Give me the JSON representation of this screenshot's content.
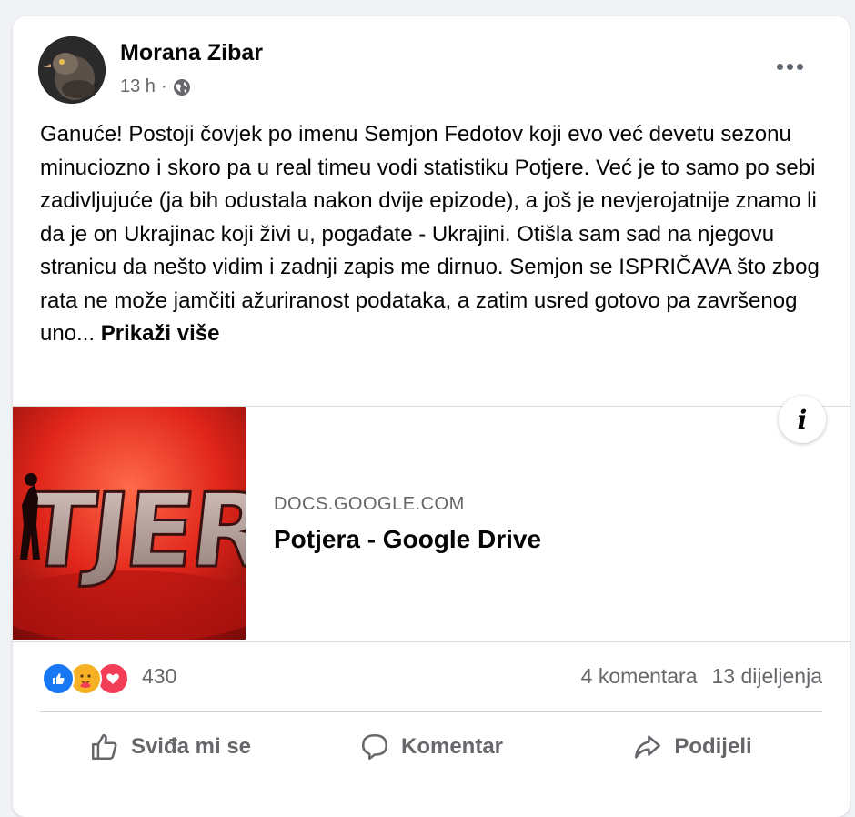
{
  "post": {
    "author": "Morana Zibar",
    "time": "13 h",
    "separator": "·",
    "visibility_icon": "globe-icon",
    "more_icon": "more-options-icon",
    "text": "Ganuće! Postoji čovjek po imenu Semjon Fedotov koji evo već devetu sezonu minuciozno i skoro pa u real timeu vodi statistiku Potjere. Već je to samo po sebi zadivljujuće (ja bih odustala nakon dvije epizode), a još je nevjerojatnije znamo li da je on Ukrajinac koji živi u, pogađate - Ukrajini. Otišla sam sad na njegovu stranicu da nešto vidim i zadnji zapis me dirnuo. Semjon se ISPRIČAVA što zbog rata ne može jamčiti ažuriranost podataka, a zatim usred gotovo pa završenog uno...",
    "see_more": "Prikaži više"
  },
  "link_preview": {
    "domain": "DOCS.GOOGLE.COM",
    "title": "Potjera - Google Drive",
    "thumb_text": "TJER",
    "info_label": "i"
  },
  "stats": {
    "reactions": [
      "like-icon",
      "care-icon",
      "love-icon"
    ],
    "reaction_count": "430",
    "comments": "4 komentara",
    "shares": "13 dijeljenja"
  },
  "actions": {
    "like": "Sviđa mi se",
    "comment": "Komentar",
    "share": "Podijeli"
  },
  "colors": {
    "like_blue": "#1877f2",
    "love_red": "#f33e58",
    "care_yellow": "#f7b125",
    "secondary_text": "#65676b"
  }
}
